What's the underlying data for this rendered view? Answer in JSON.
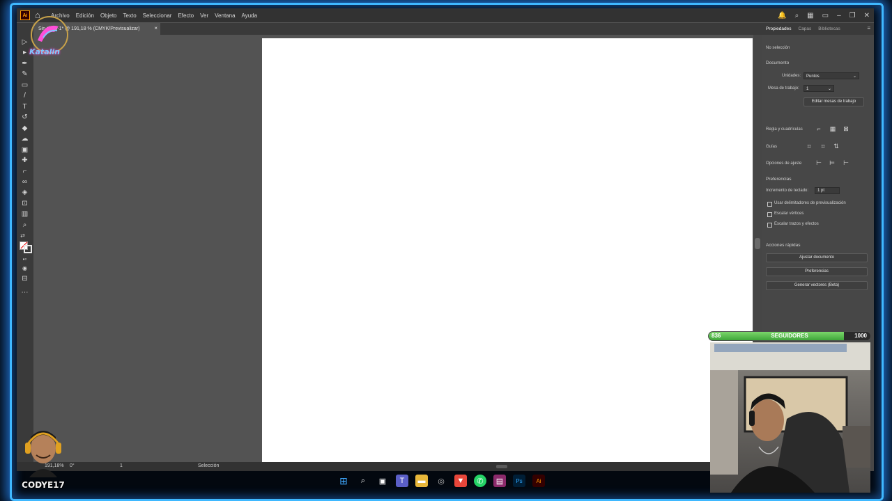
{
  "app": {
    "menu": [
      "Archivo",
      "Edición",
      "Objeto",
      "Texto",
      "Seleccionar",
      "Efecto",
      "Ver",
      "Ventana",
      "Ayuda"
    ],
    "logo_text": "Ai"
  },
  "document_tab": {
    "title": "Sin título-1* @ 191,18 % (CMYK/Previsualizar)",
    "close": "×"
  },
  "status": {
    "zoom": "191,18%",
    "rotation": "0°",
    "artboard_number": "1",
    "tool": "Selección"
  },
  "properties_panel": {
    "tabs": [
      "Propiedades",
      "Capas",
      "Bibliotecas"
    ],
    "no_selection": "No selección",
    "document_heading": "Documento",
    "units_label": "Unidades:",
    "units_value": "Puntos",
    "artboard_label": "Mesa de trabajo:",
    "artboard_value": "1",
    "edit_artboards_button": "Editar mesas de trabajo",
    "rulers_grid_label": "Regla y cuadrículas",
    "guides_label": "Guías",
    "snap_options_label": "Opciones de ajuste",
    "preferences_heading": "Preferencias",
    "keyboard_increment_label": "Incremento de teclado:",
    "keyboard_increment_value": "1 pt",
    "checkboxes": [
      "Usar delimitadores de previsualización",
      "Escalar vértices",
      "Escalar trazos y efectos"
    ],
    "quick_actions_heading": "Acciones rápidas",
    "quick_actions": [
      "Ajustar documento",
      "Preferencias",
      "Generar vectores (Beta)"
    ]
  },
  "overlay": {
    "followers_title": "SEGUIDORES",
    "followers_current": "836",
    "followers_goal": "1000",
    "followers_progress": 0.836,
    "streamer_name": "CODYE17",
    "corner_logo_text": "Katalin"
  }
}
